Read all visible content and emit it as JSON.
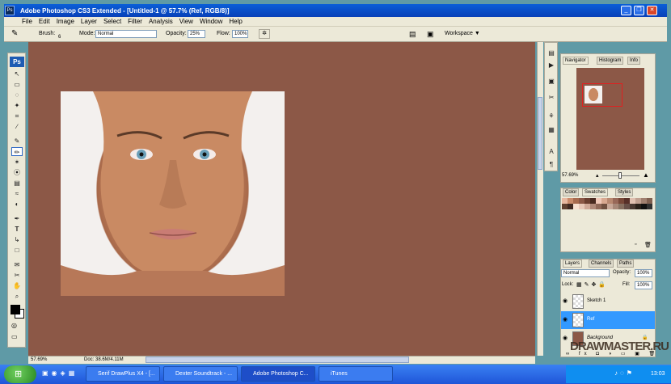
{
  "window": {
    "title": "Adobe Photoshop CS3 Extended - [Untitled-1 @ 57.7% (Ref, RGB/8)]",
    "app_icon_text": "Ps"
  },
  "menu": [
    "File",
    "Edit",
    "Image",
    "Layer",
    "Select",
    "Filter",
    "Analysis",
    "View",
    "Window",
    "Help"
  ],
  "options_bar": {
    "brush_label": "Brush:",
    "brush_size": "6",
    "mode_label": "Mode:",
    "mode_value": "Normal",
    "opacity_label": "Opacity:",
    "opacity_value": "25%",
    "flow_label": "Flow:",
    "flow_value": "100%",
    "workspace_label": "Workspace ▼"
  },
  "toolbox": {
    "logo": "Ps",
    "tools": [
      "↖",
      "▭",
      "◌",
      "✦",
      "⌗",
      "∕",
      "✎",
      "✏",
      "✶",
      "⦿",
      "▤",
      "≈",
      "◐",
      "✒",
      "T",
      "↳",
      "□",
      "✉",
      "✂",
      "✋",
      "⌕"
    ]
  },
  "document": {
    "zoom_status": "57.69%",
    "doc_status": "Doc: 38.6M/4.11M"
  },
  "navigator": {
    "tabs": [
      "Navigator",
      "Histogram",
      "Info"
    ],
    "zoom": "57.69%"
  },
  "swatch_panel": {
    "tabs": [
      "Color",
      "Swatches",
      "Styles"
    ],
    "colors": [
      "#e8b8a0",
      "#c98a6a",
      "#a86a4e",
      "#8c5847",
      "#6b3e30",
      "#4a2a20",
      "#f0c8b8",
      "#d8a890",
      "#b88870",
      "#986858",
      "#784838",
      "#583028",
      "#e0c0b0",
      "#c0a090",
      "#a08070",
      "#806050",
      "#604030",
      "#402820",
      "#f8e0d0",
      "#e8c8b8",
      "#d0a898",
      "#b08878",
      "#906858",
      "#705040",
      "#c8a898",
      "#a88878",
      "#887060",
      "#685048",
      "#483830",
      "#282018",
      "#101010",
      "#303030"
    ]
  },
  "layers_panel": {
    "tabs": [
      "Layers",
      "Channels",
      "Paths"
    ],
    "blend_mode": "Normal",
    "opacity_label": "Opacity:",
    "opacity_value": "100%",
    "lock_label": "Lock:",
    "fill_label": "Fill:",
    "fill_value": "100%",
    "layers": [
      {
        "name": "Sketch 1",
        "selected": false
      },
      {
        "name": "Ref",
        "selected": true
      },
      {
        "name": "Background",
        "selected": false
      }
    ]
  },
  "taskbar": {
    "tasks": [
      {
        "label": "Serif DrawPlus X4 - [...",
        "active": false
      },
      {
        "label": "Dexter Soundtrack - ...",
        "active": false
      },
      {
        "label": "Adobe Photoshop C...",
        "active": true
      },
      {
        "label": "iTunes",
        "active": false
      }
    ],
    "clock": "13:03",
    "watermark": "DRAWMASTER.RU"
  }
}
